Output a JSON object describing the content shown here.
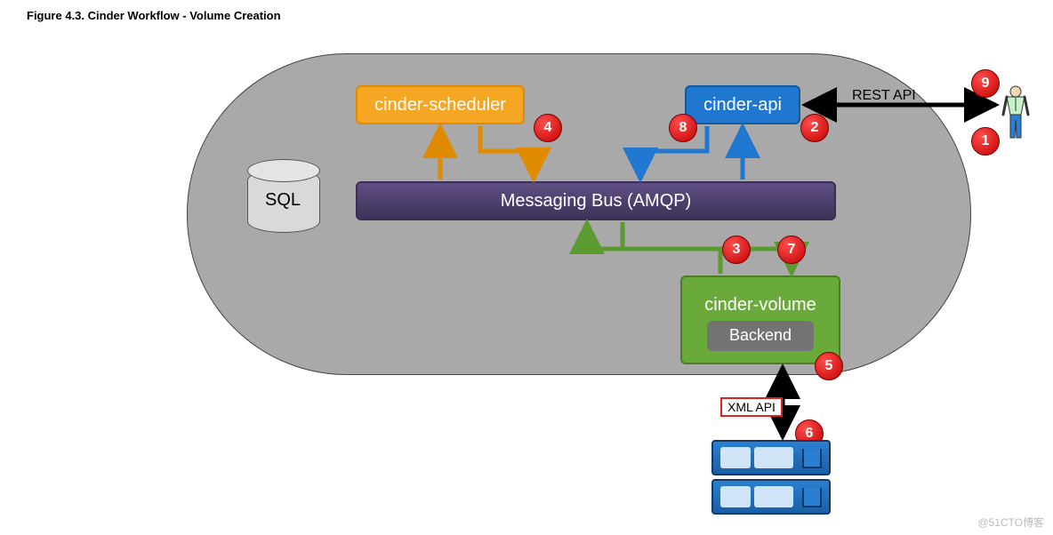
{
  "figure": {
    "title": "Figure 4.3. Cinder Workflow - Volume Creation"
  },
  "nodes": {
    "scheduler": "cinder-scheduler",
    "api": "cinder-api",
    "bus": "Messaging Bus (AMQP)",
    "volume": "cinder-volume",
    "backend": "Backend",
    "sql": "SQL"
  },
  "labels": {
    "xml_api": "XML API",
    "rest_api": "REST API"
  },
  "markers": {
    "m1": "1",
    "m2": "2",
    "m3": "3",
    "m4": "4",
    "m5": "5",
    "m6": "6",
    "m7": "7",
    "m8": "8",
    "m9": "9"
  },
  "colors": {
    "scheduler": "#f5a623",
    "api": "#1f77d0",
    "bus": "#4a3d6b",
    "volume": "#6aaa3a",
    "marker": "#d60000",
    "storage": "#1a5fa6"
  },
  "watermark": "@51CTO博客"
}
